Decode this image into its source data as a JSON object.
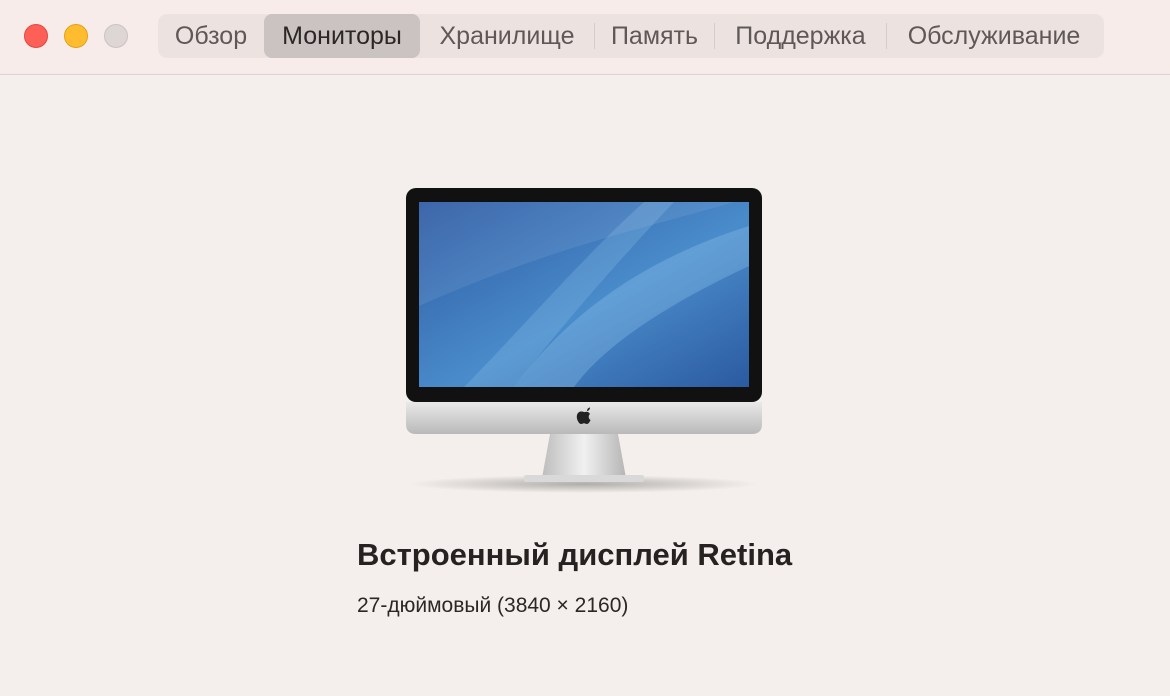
{
  "tabs": [
    {
      "label": "Обзор",
      "active": false
    },
    {
      "label": "Мониторы",
      "active": true
    },
    {
      "label": "Хранилище",
      "active": false
    },
    {
      "label": "Память",
      "active": false
    },
    {
      "label": "Поддержка",
      "active": false
    },
    {
      "label": "Обслуживание",
      "active": false
    }
  ],
  "display": {
    "name": "Встроенный дисплей Retina",
    "description": "27-дюймовый (3840 × 2160)"
  },
  "colors": {
    "close": "#fe5f57",
    "minimize": "#febc2e",
    "zoom_inactive": "#ddd6d4",
    "background": "#f4efec",
    "active_tab": "#cbc3c1"
  },
  "icons": [
    "close-icon",
    "minimize-icon",
    "zoom-icon",
    "imac-display-icon",
    "apple-logo-icon"
  ]
}
